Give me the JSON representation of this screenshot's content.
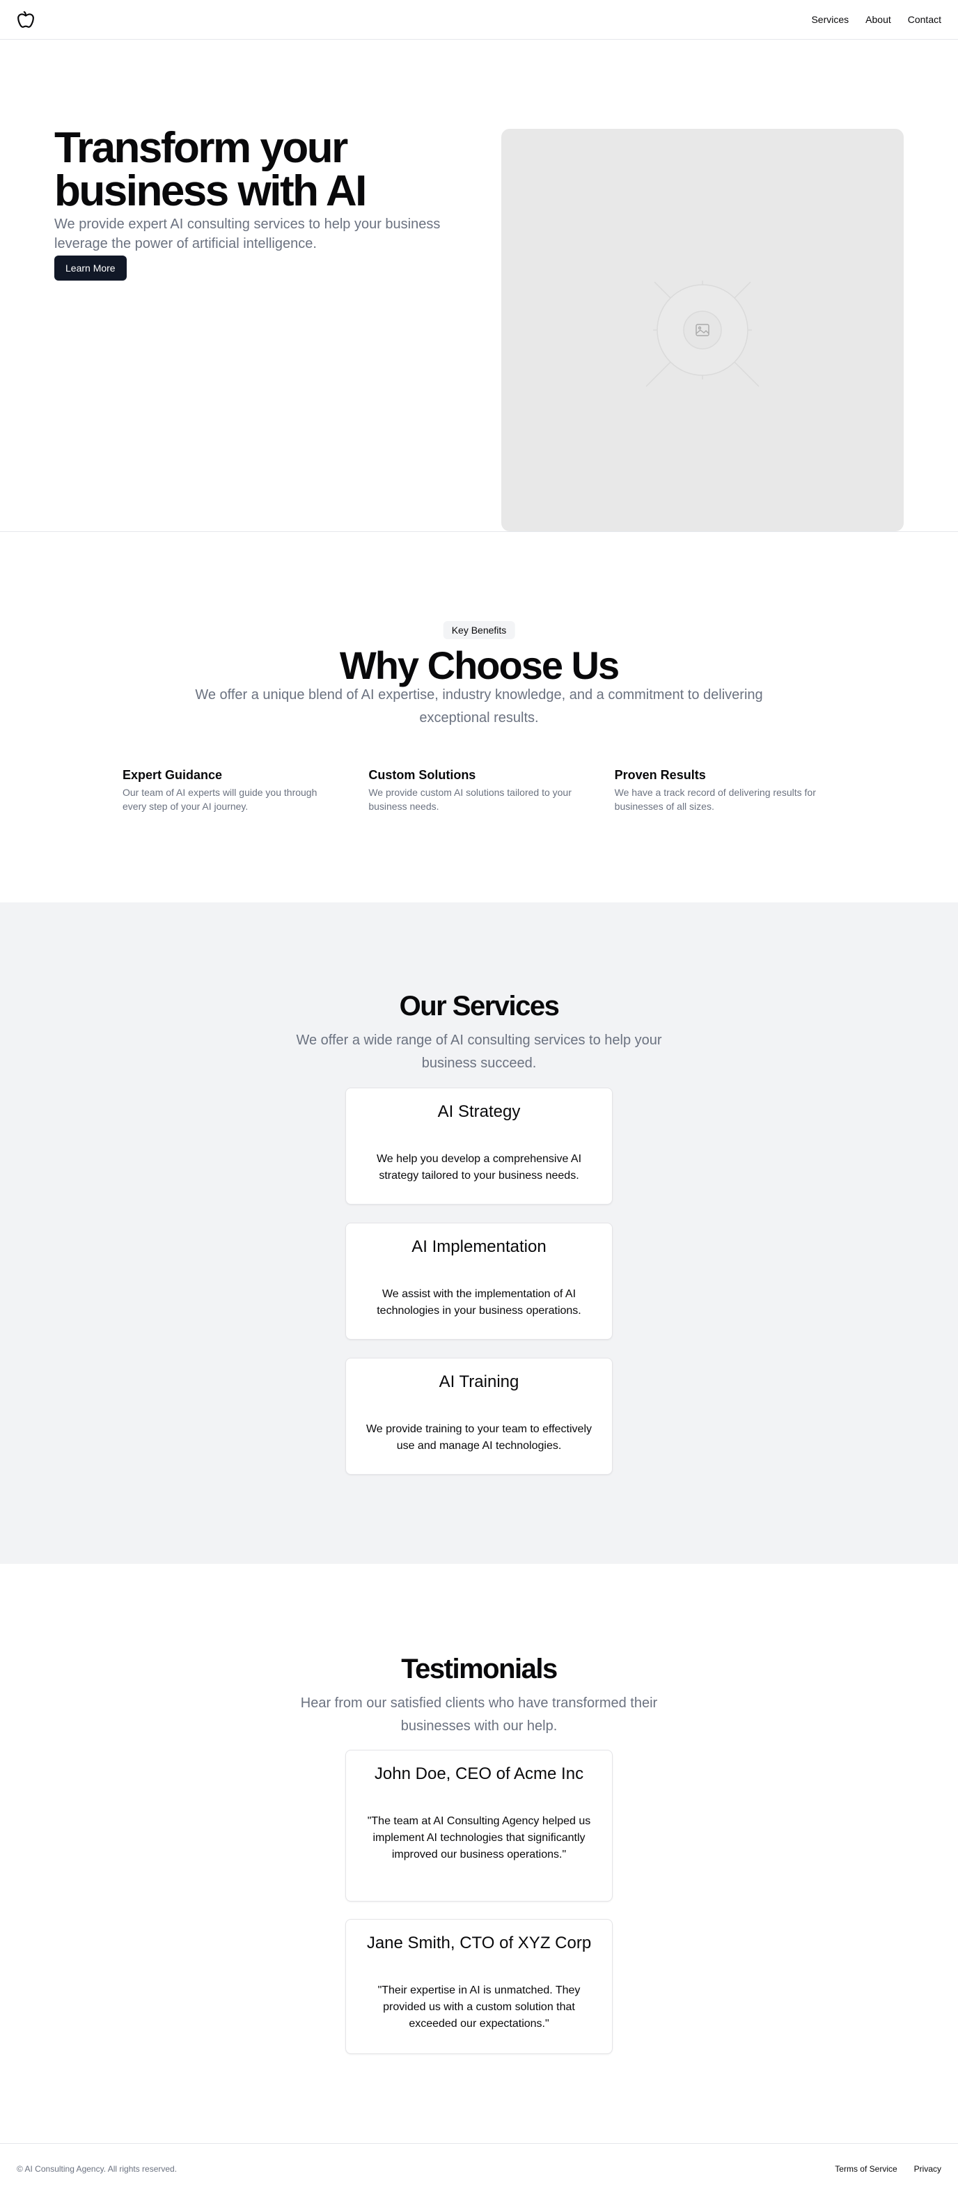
{
  "header": {
    "logo_icon": "apple-outline-icon",
    "nav": [
      "Services",
      "About",
      "Contact"
    ]
  },
  "hero": {
    "title": "Transform your business with AI",
    "subtitle": "We provide expert AI consulting services to help your business leverage the power of artificial intelligence.",
    "cta_label": "Learn More",
    "image_icon": "image-placeholder-icon",
    "image_bg": "#e8e8e8",
    "cta_bg": "#111827"
  },
  "benefits": {
    "badge": "Key Benefits",
    "title": "Why Choose Us",
    "subtitle": "We offer a unique blend of AI expertise, industry knowledge, and a commitment to delivering exceptional results.",
    "items": [
      {
        "title": "Expert Guidance",
        "desc": "Our team of AI experts will guide you through every step of your AI journey."
      },
      {
        "title": "Custom Solutions",
        "desc": "We provide custom AI solutions tailored to your business needs."
      },
      {
        "title": "Proven Results",
        "desc": "We have a track record of delivering results for businesses of all sizes."
      }
    ]
  },
  "services": {
    "title": "Our Services",
    "subtitle": "We offer a wide range of AI consulting services to help your business succeed.",
    "bg": "#f2f3f5",
    "cards": [
      {
        "title": "AI Strategy",
        "body": "We help you develop a comprehensive AI strategy tailored to your business needs."
      },
      {
        "title": "AI Implementation",
        "body": "We assist with the implementation of AI technologies in your business operations."
      },
      {
        "title": "AI Training",
        "body": "We provide training to your team to effectively use and manage AI technologies."
      }
    ]
  },
  "testimonials": {
    "title": "Testimonials",
    "subtitle": "Hear from our satisfied clients who have transformed their businesses with our help.",
    "cards": [
      {
        "title": "John Doe, CEO of Acme Inc",
        "body": "\"The team at AI Consulting Agency helped us implement AI technologies that significantly improved our business operations.\""
      },
      {
        "title": "Jane Smith, CTO of XYZ Corp",
        "body": "\"Their expertise in AI is unmatched. They provided us with a custom solution that exceeded our expectations.\""
      }
    ]
  },
  "footer": {
    "copyright": "© AI Consulting Agency. All rights reserved.",
    "links": [
      "Terms of Service",
      "Privacy"
    ]
  }
}
